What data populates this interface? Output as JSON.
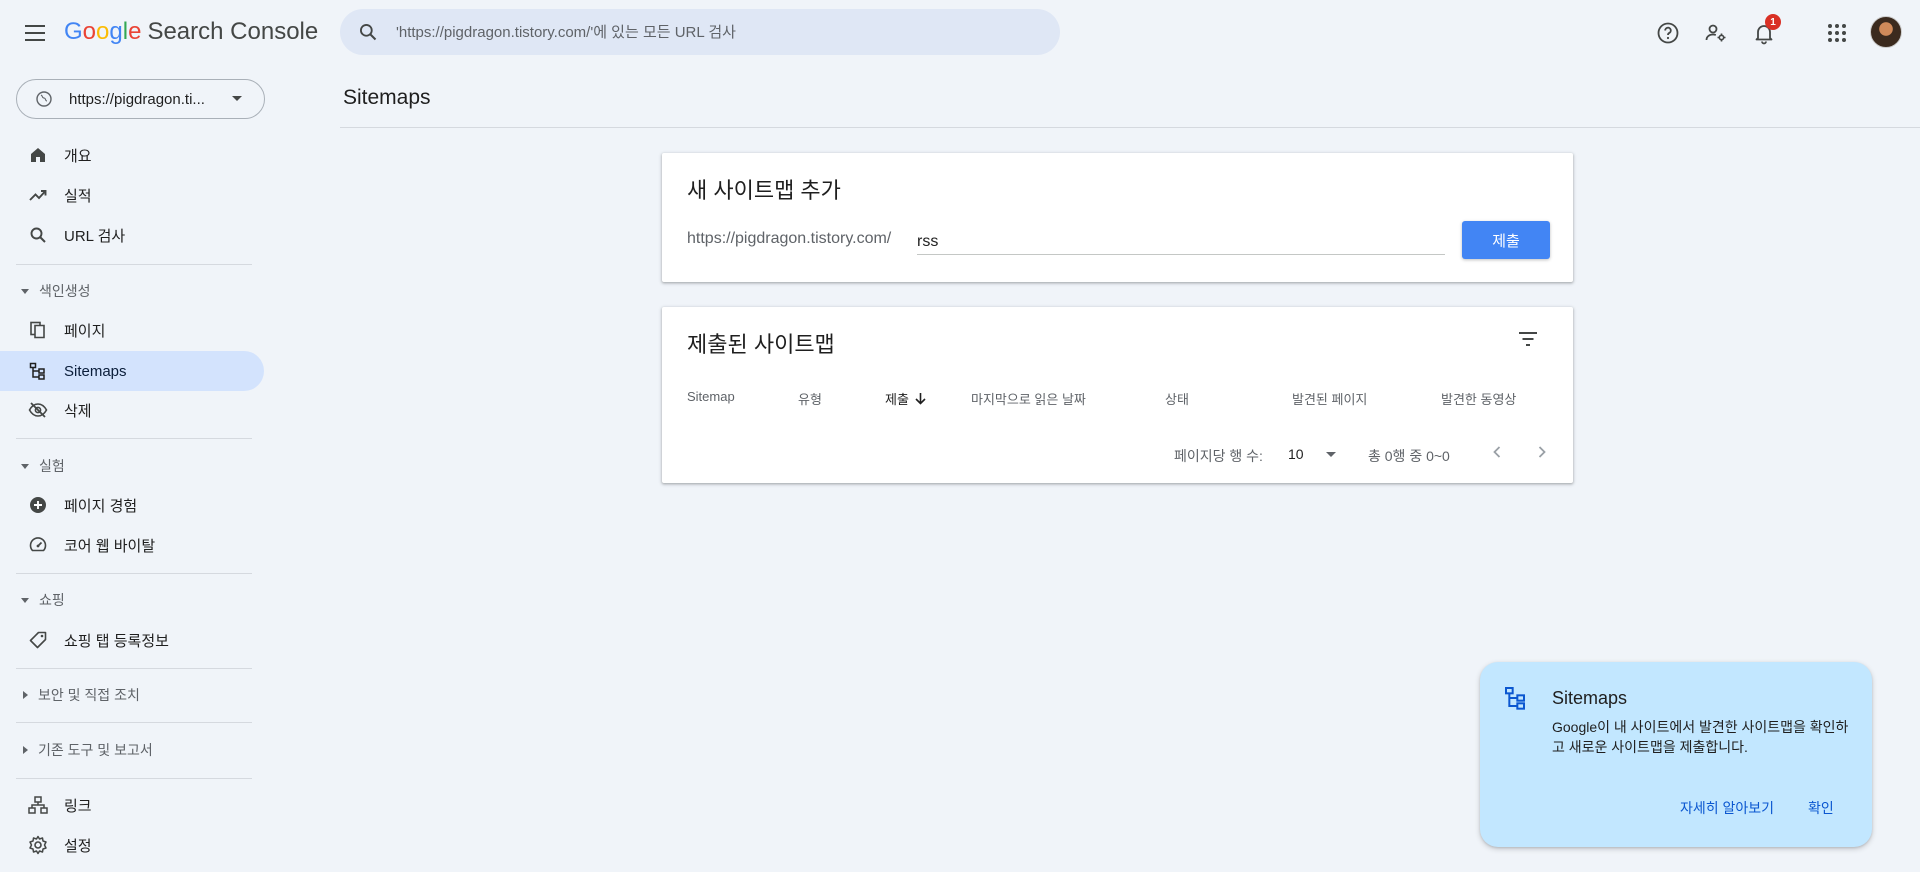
{
  "header": {
    "logo_google": [
      "G",
      "o",
      "o",
      "g",
      "l",
      "e"
    ],
    "logo_product": "Search Console",
    "search_placeholder": "'https://pigdragon.tistory.com/'에 있는 모든 URL 검사",
    "notification_count": "1"
  },
  "sidebar": {
    "property": "https://pigdragon.ti...",
    "top_items": [
      {
        "label": "개요",
        "icon": "home-icon"
      },
      {
        "label": "실적",
        "icon": "trending-up-icon"
      },
      {
        "label": "URL 검사",
        "icon": "search-icon"
      }
    ],
    "sections": [
      {
        "label": "색인생성",
        "expanded": true,
        "items": [
          {
            "label": "페이지",
            "icon": "pages-icon"
          },
          {
            "label": "Sitemaps",
            "icon": "sitemap-icon",
            "active": true
          },
          {
            "label": "삭제",
            "icon": "eye-off-icon"
          }
        ]
      },
      {
        "label": "실험",
        "expanded": true,
        "items": [
          {
            "label": "페이지 경험",
            "icon": "plus-circle-icon"
          },
          {
            "label": "코어 웹 바이탈",
            "icon": "speedometer-icon"
          }
        ]
      },
      {
        "label": "쇼핑",
        "expanded": true,
        "items": [
          {
            "label": "쇼핑 탭 등록정보",
            "icon": "tag-icon"
          }
        ]
      },
      {
        "label": "보안 및 직접 조치",
        "expanded": false
      },
      {
        "label": "기존 도구 및 보고서",
        "expanded": false
      }
    ],
    "bottom_items": [
      {
        "label": "링크",
        "icon": "links-icon"
      },
      {
        "label": "설정",
        "icon": "gear-icon"
      }
    ]
  },
  "main": {
    "title": "Sitemaps",
    "add_card": {
      "title": "새 사이트맵 추가",
      "url_prefix": "https://pigdragon.tistory.com/",
      "input_value": "rss",
      "submit_label": "제출"
    },
    "submitted_card": {
      "title": "제출된 사이트맵",
      "columns": [
        "Sitemap",
        "유형",
        "제출",
        "마지막으로 읽은 날짜",
        "상태",
        "발견된 페이지",
        "발견한 동영상"
      ],
      "sorted_column": "제출",
      "rows": [],
      "rows_per_page_label": "페이지당 행 수:",
      "rows_per_page": "10",
      "range_label": "총 0행 중 0~0"
    }
  },
  "toast": {
    "title": "Sitemaps",
    "body": "Google이 내 사이트에서 발견한 사이트맵을 확인하고 새로운 사이트맵을 제출합니다.",
    "learn_more": "자세히 알아보기",
    "ok": "확인"
  },
  "colors": {
    "background": "#f0f4f9",
    "accent": "#4285f4",
    "active_nav": "#d3e3fd",
    "toast": "#c2e7ff",
    "badge": "#d93025"
  }
}
